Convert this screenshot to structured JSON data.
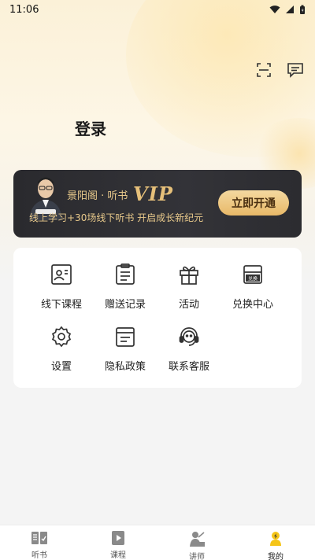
{
  "status_bar": {
    "time": "11:06"
  },
  "header": {
    "title": "登录"
  },
  "vip_banner": {
    "brand": "景阳阁 · 听书",
    "logo_text": "VIP",
    "subtitle": "线上学习+30场线下听书 开启成长新纪元",
    "button_label": "立即开通"
  },
  "menu": {
    "items": [
      {
        "label": "线下课程",
        "icon": "offline-course-icon"
      },
      {
        "label": "赠送记录",
        "icon": "gift-record-icon"
      },
      {
        "label": "活动",
        "icon": "gift-box-icon"
      },
      {
        "label": "兑换中心",
        "icon": "exchange-icon",
        "badge": "兑换"
      },
      {
        "label": "设置",
        "icon": "settings-icon"
      },
      {
        "label": "隐私政策",
        "icon": "privacy-policy-icon"
      },
      {
        "label": "联系客服",
        "icon": "customer-service-icon"
      }
    ]
  },
  "tabs": [
    {
      "label": "听书",
      "icon": "book-icon",
      "active": false
    },
    {
      "label": "课程",
      "icon": "course-play-icon",
      "active": false
    },
    {
      "label": "讲师",
      "icon": "lecturer-icon",
      "active": false
    },
    {
      "label": "我的",
      "icon": "profile-icon",
      "active": true
    }
  ],
  "colors": {
    "accent": "#f5c518",
    "vip_gold": "#e8c98b",
    "vip_bg": "#2e2e32"
  }
}
